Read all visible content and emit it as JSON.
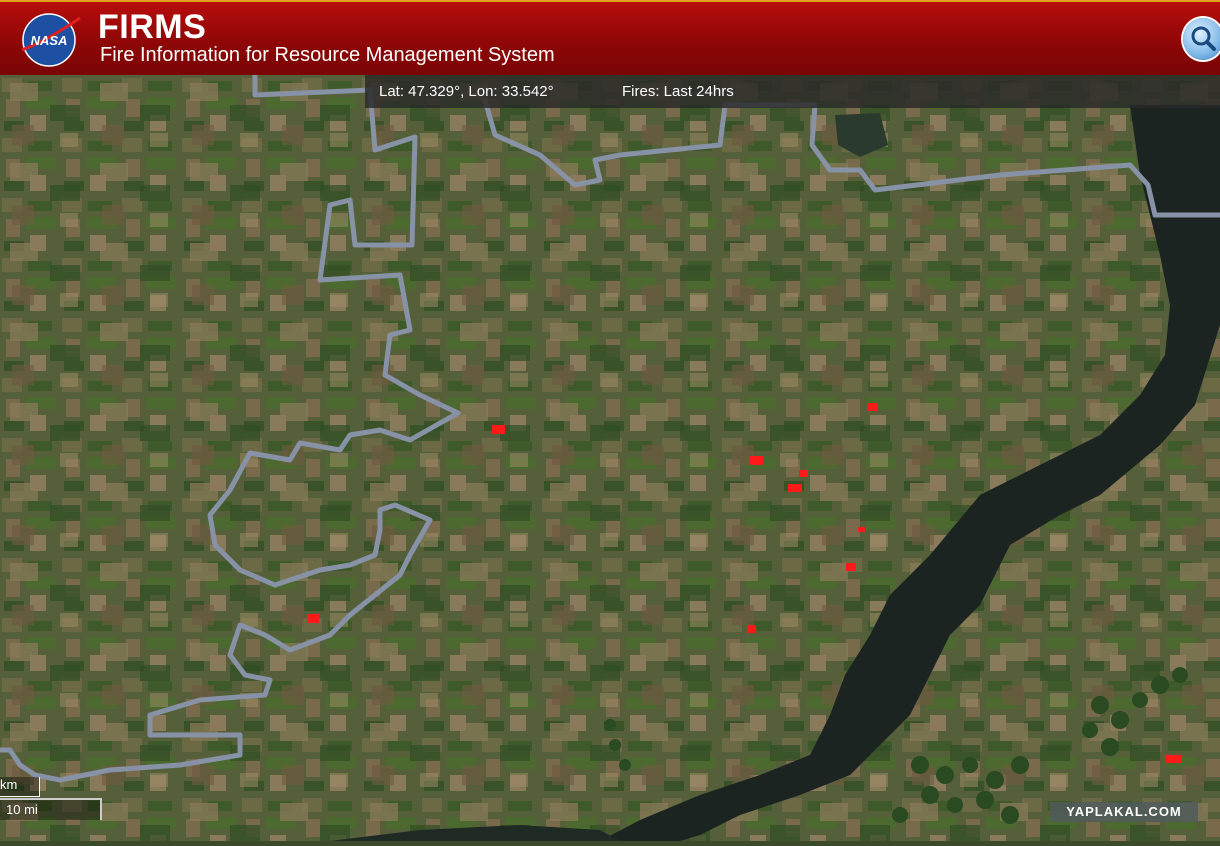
{
  "header": {
    "title": "FIRMS",
    "subtitle": "Fire Information for Resource Management System",
    "logo_text": "NASA",
    "background": "#9e0909"
  },
  "coordinates": {
    "text": "Lat: 47.329°, Lon: 33.542°",
    "fires_label": "Fires: Last 24hrs"
  },
  "scale": {
    "km_label": "km",
    "mi_label": "10 mi"
  },
  "watermark": "YAPLAKAL.COM",
  "map": {
    "fire_color": "#ff1a1a",
    "border_color": "#8a95a8",
    "river_color": "#1a231f",
    "land_color": "#4f5a33"
  },
  "icons": {
    "search": "search-icon",
    "logo": "nasa-logo"
  }
}
